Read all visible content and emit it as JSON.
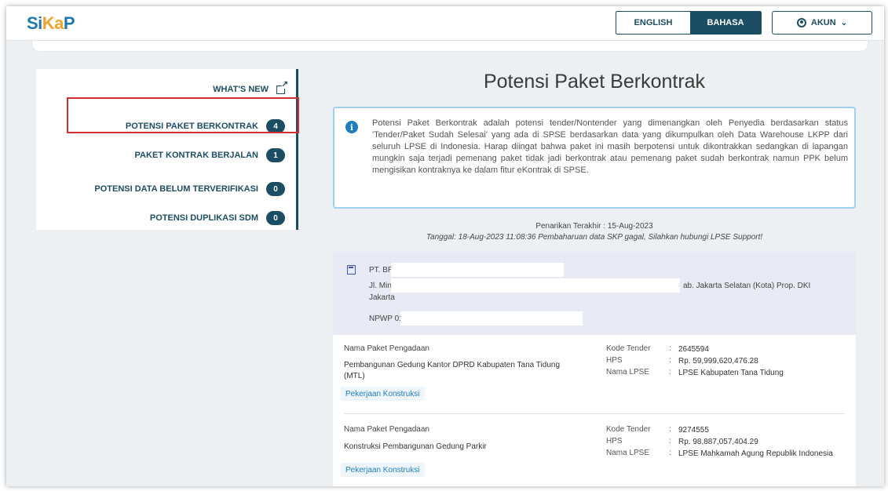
{
  "header": {
    "logo": {
      "part1": "Si",
      "part2": "Ka",
      "part3": "P"
    },
    "lang_en": "ENGLISH",
    "lang_id": "BAHASA",
    "account": "AKUN"
  },
  "sidebar": {
    "items": [
      {
        "label": "WHAT'S NEW",
        "icon": "external-link-icon"
      },
      {
        "label": "POTENSI PAKET BERKONTRAK",
        "badge": "4"
      },
      {
        "label": "PAKET KONTRAK BERJALAN",
        "badge": "1"
      },
      {
        "label": "POTENSI DATA BELUM TERVERIFIKASI",
        "badge": "0"
      },
      {
        "label": "POTENSI DUPLIKASI SDM",
        "badge": "0"
      }
    ]
  },
  "main": {
    "title": "Potensi Paket Berkontrak",
    "info": "Potensi Paket Berkontrak adalah potensi tender/Nontender yang dimenangkan oleh Penyedia berdasarkan status 'Tender/Paket Sudah Selesai' yang ada di SPSE berdasarkan data yang dikumpulkan oleh Data Warehouse LKPP dari seluruh LPSE di Indonesia. Harap diingat bahwa paket ini masih berpotensi untuk dikontrakkan sedangkan di lapangan mungkin saja terjadi pemenang paket tidak jadi berkontrak atau pemenang paket sudah berkontrak namun PPK belum mengisikan kontraknya ke dalam fitur eKontrak di SPSE.",
    "last_pull": "Penarikan Terakhir : 15-Aug-2023",
    "pull_status": "Tanggal: 18-Aug-2023 11:08:36 Pembaharuan data SKP gagal, Silahkan hubungi LPSE Support!",
    "company": {
      "name": "PT. BR",
      "address_start": "Jl. Min",
      "address_end": "ab. Jakarta Selatan (Kota) Prop. DKI",
      "address_line2": "Jakarta",
      "npwp": "NPWP 01"
    },
    "packages": [
      {
        "label": "Nama Paket Pengadaan",
        "name": "Pembangunan Gedung Kantor DPRD Kabupaten Tana Tidung (MTL)",
        "category": "Pekerjaan Konstruksi",
        "kode_label": "Kode Tender",
        "kode": "2645594",
        "hps_label": "HPS",
        "hps": "Rp. 59,999,620,476.28",
        "lpse_label": "Nama LPSE",
        "lpse": "LPSE Kabupaten Tana Tidung"
      },
      {
        "label": "Nama Paket Pengadaan",
        "name": "Konstruksi Pembangunan Gedung Parkir",
        "category": "Pekerjaan Konstruksi",
        "kode_label": "Kode Tender",
        "kode": "9274555",
        "hps_label": "HPS",
        "hps": "Rp. 98,887,057,404.29",
        "lpse_label": "Nama LPSE",
        "lpse": "LPSE Mahkamah Agung Republik Indonesia"
      }
    ]
  }
}
